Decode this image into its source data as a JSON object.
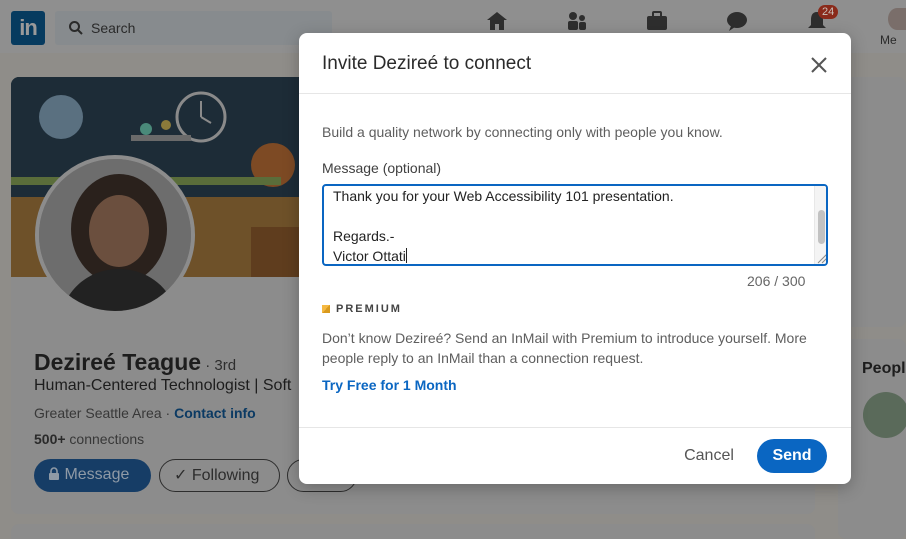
{
  "nav": {
    "logo": "in",
    "search_placeholder": "Search",
    "notification_count": "24",
    "me_label": "Me"
  },
  "profile": {
    "name": "Dezireé Teague",
    "degree": " · 3rd",
    "headline": "Human-Centered Technologist | Soft",
    "location": "Greater Seattle Area · ",
    "contact_info": "Contact info",
    "connections_count": "500+",
    "connections_label": " connections",
    "message_button": "Message",
    "following_button": "✓ Following"
  },
  "sidebar": {
    "people_heading": "People"
  },
  "modal": {
    "title": "Invite Dezireé to connect",
    "intro": "Build a quality network by connecting only with people you know.",
    "message_label": "Message (optional)",
    "message_lines": [
      "Thank you for your Web Accessibility 101 presentation.",
      "",
      "Regards.-",
      "Victor Ottati"
    ],
    "char_count": "206 / 300",
    "premium_label": "PREMIUM",
    "premium_text": "Don’t know Dezireé? Send an InMail with Premium to introduce yourself. More people reply to an InMail than a connection request.",
    "try_free_link": "Try Free for 1 Month",
    "cancel_button": "Cancel",
    "send_button": "Send"
  },
  "colors": {
    "accent": "#0a66c2",
    "overlay_bg": "#8f8d89"
  }
}
